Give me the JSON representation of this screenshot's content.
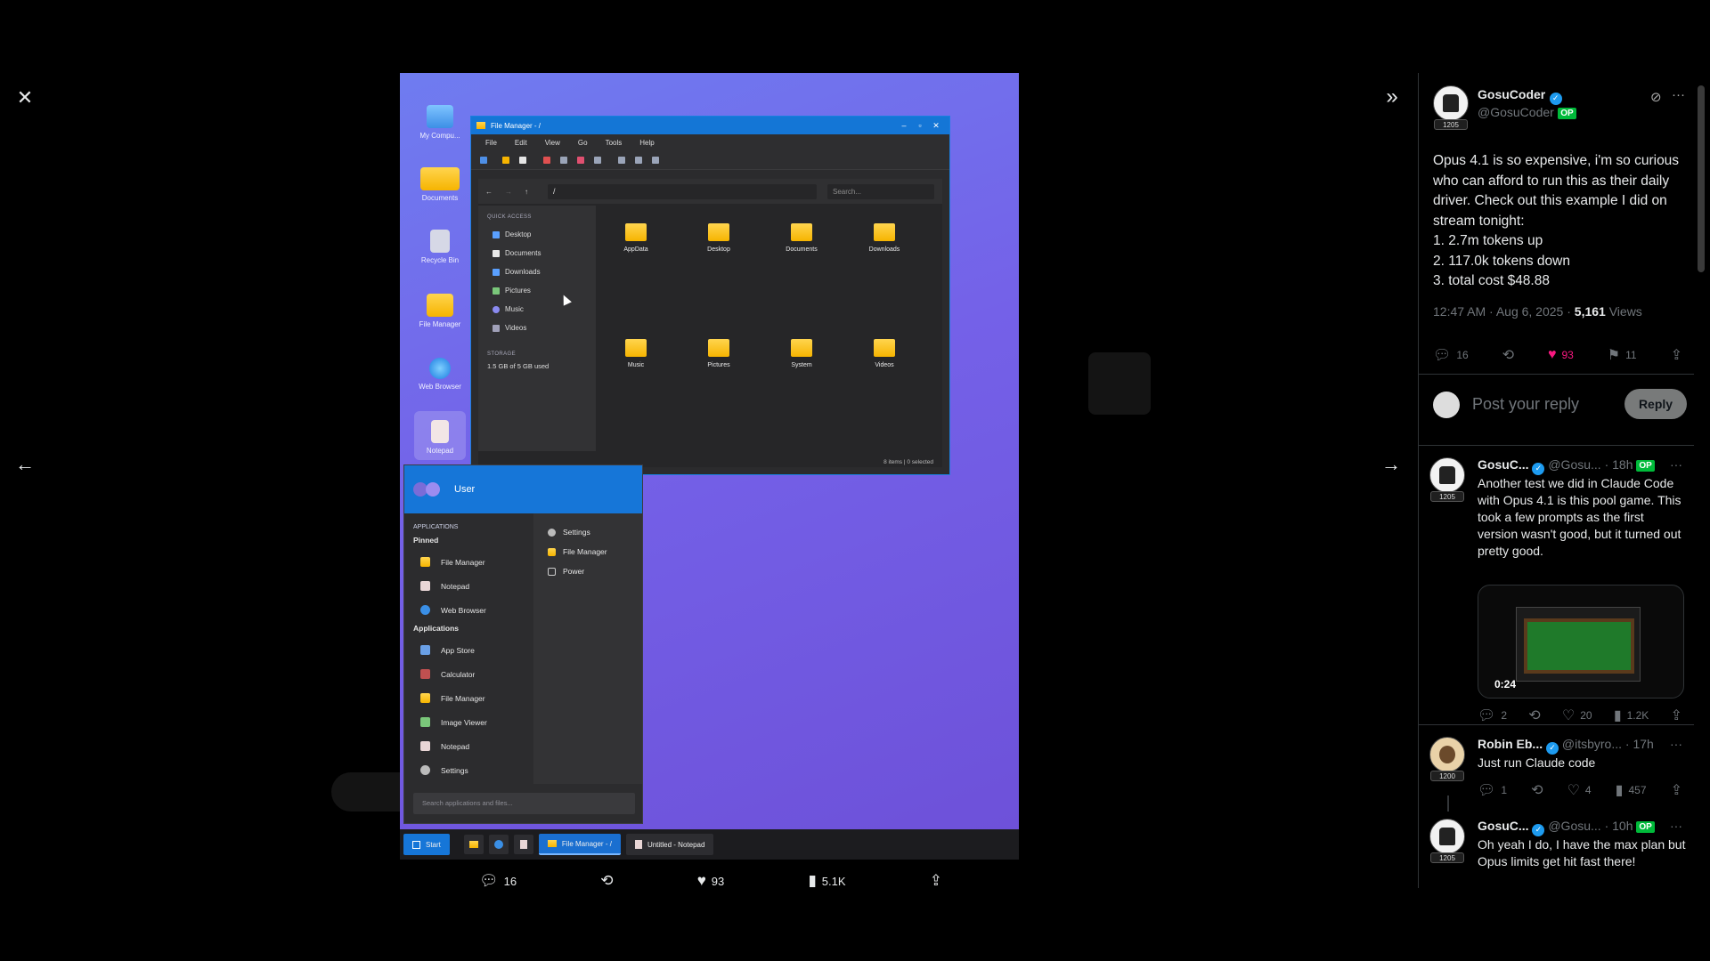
{
  "viewer": {
    "media_actions": {
      "replies": "16",
      "likes": "93",
      "views": "5.1K"
    }
  },
  "media": {
    "desktop_icons": [
      "My Compu...",
      "Documents",
      "Recycle Bin",
      "File Manager",
      "Web Browser",
      "Notepad"
    ],
    "file_manager": {
      "title": "File Manager - /",
      "menu": [
        "File",
        "Edit",
        "View",
        "Go",
        "Tools",
        "Help"
      ],
      "path": "/",
      "search_placeholder": "Search...",
      "quick_access_heading": "QUICK ACCESS",
      "quick_access": [
        "Desktop",
        "Documents",
        "Downloads",
        "Pictures",
        "Music",
        "Videos"
      ],
      "storage_heading": "STORAGE",
      "storage_text": "1.5 GB of 5 GB used",
      "folders": [
        "AppData",
        "Desktop",
        "Documents",
        "Downloads",
        "Music",
        "Pictures",
        "System",
        "Videos"
      ],
      "status": "8 items | 0 selected"
    },
    "start_menu": {
      "user": "User",
      "applications_caption": "APPLICATIONS",
      "pinned_heading": "Pinned",
      "pinned": [
        "File Manager",
        "Notepad",
        "Web Browser"
      ],
      "applications_heading": "Applications",
      "applications": [
        "App Store",
        "Calculator",
        "File Manager",
        "Image Viewer",
        "Notepad",
        "Settings"
      ],
      "right_items": [
        "Settings",
        "File Manager",
        "Power"
      ],
      "search_placeholder": "Search applications and files..."
    },
    "taskbar": {
      "start_label": "Start",
      "apps": [
        "File Manager - /",
        "Untitled - Notepad"
      ]
    }
  },
  "post": {
    "author_name": "GosuCoder",
    "author_handle": "@GosuCoder",
    "op_badge": "OP",
    "avatar_badge": "1205",
    "text": "Opus 4.1 is so expensive, i'm so curious who can afford to run this as their daily driver. Check out this example I did on stream tonight:\n1. 2.7m tokens up\n2. 117.0k tokens down\n3. total cost $48.88",
    "timestamp": "12:47 AM · Aug 6, 2025 · ",
    "views_count": "5,161",
    "views_label": " Views",
    "replies": "16",
    "likes": "93",
    "bookmarks": "11",
    "reply_placeholder": "Post your reply",
    "reply_button": "Reply"
  },
  "replies": [
    {
      "name": "GosuC...",
      "handle": "@Gosu...",
      "time": "· 18h",
      "op": "OP",
      "avatar_badge": "1205",
      "text": "Another test we did in Claude Code with Opus 4.1 is this pool game. This took a few prompts as the first version wasn't good, but it turned out pretty good.",
      "video_time": "0:24",
      "replies": "2",
      "likes": "20",
      "views": "1.2K"
    },
    {
      "name": "Robin Eb...",
      "handle": "@itsbyro...",
      "time": "· 17h",
      "avatar_badge": "1200",
      "text": "Just run Claude code",
      "replies": "1",
      "likes": "4",
      "views": "457"
    },
    {
      "name": "GosuC...",
      "handle": "@Gosu...",
      "time": "· 10h",
      "op": "OP",
      "avatar_badge": "1205",
      "text": "Oh yeah I do, I have the max plan but Opus limits get hit fast there!"
    }
  ]
}
